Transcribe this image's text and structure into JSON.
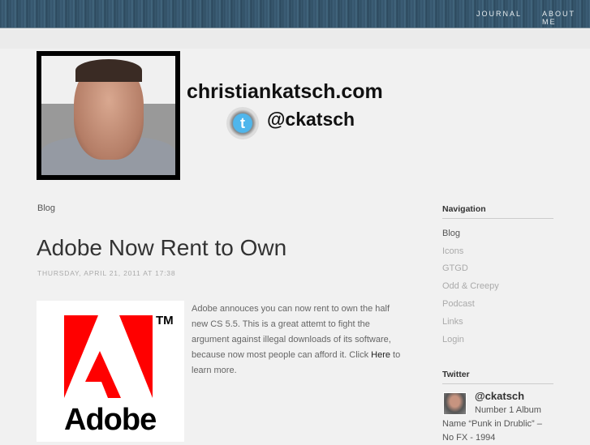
{
  "topnav": {
    "items": [
      "JOURNAL",
      "ABOUT ME"
    ]
  },
  "banner": {
    "site": "christiankatsch.com",
    "handle": "@ckatsch"
  },
  "breadcrumb": "Blog",
  "post": {
    "title": "Adobe Now Rent to Own",
    "date": "THURSDAY, APRIL 21, 2011 AT 17:38",
    "image_text": "Adobe",
    "image_tm": "TM",
    "body_before": "Adobe annouces you can now rent to own the half new CS 5.5. This is a great attemt to fight the argument against illegal downloads of its software, because now most people can afford it. Click ",
    "link": "Here",
    "body_after": " to learn more."
  },
  "sidebar": {
    "nav_title": "Navigation",
    "nav_items": [
      "Blog",
      "Icons",
      "GTGD",
      "Odd & Creepy",
      "Podcast",
      "Links",
      "Login"
    ],
    "twitter_title": "Twitter",
    "twitter_user": "@ckatsch",
    "tweet": "Number 1 Album Name “Punk in Drublic” – No FX - 1994"
  }
}
